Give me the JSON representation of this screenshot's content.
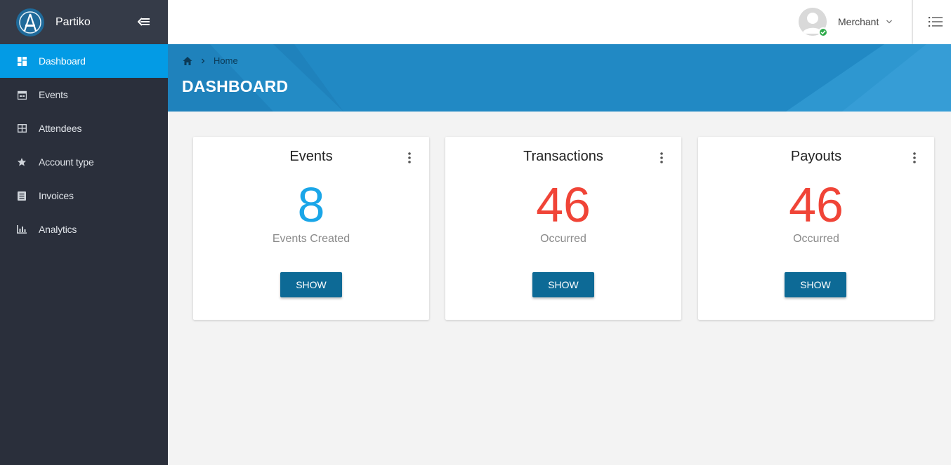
{
  "brand": {
    "name": "Partiko",
    "logo_icon": "partiko-logo-icon"
  },
  "sidebar": {
    "items": [
      {
        "label": "Dashboard",
        "icon": "dashboard-icon",
        "active": true
      },
      {
        "label": "Events",
        "icon": "calendar-icon",
        "active": false
      },
      {
        "label": "Attendees",
        "icon": "table-icon",
        "active": false
      },
      {
        "label": "Account type",
        "icon": "star-icon",
        "active": false
      },
      {
        "label": "Invoices",
        "icon": "document-icon",
        "active": false
      },
      {
        "label": "Analytics",
        "icon": "bar-chart-icon",
        "active": false
      }
    ]
  },
  "header": {
    "user_name": "Merchant",
    "status": "online"
  },
  "breadcrumb": {
    "home_label": "Home"
  },
  "page": {
    "title": "DASHBOARD"
  },
  "cards": [
    {
      "title": "Events",
      "value": "8",
      "subtitle": "Events Created",
      "button_label": "SHOW",
      "value_color": "#1aa6e8"
    },
    {
      "title": "Transactions",
      "value": "46",
      "subtitle": "Occurred",
      "button_label": "SHOW",
      "value_color": "#f04437"
    },
    {
      "title": "Payouts",
      "value": "46",
      "subtitle": "Occurred",
      "button_label": "SHOW",
      "value_color": "#f04437"
    }
  ],
  "colors": {
    "sidebar_bg": "#2a2f3b",
    "active_item": "#039be5",
    "banner": "#2189c4",
    "button": "#0d6a96",
    "online": "#2faa4b"
  }
}
